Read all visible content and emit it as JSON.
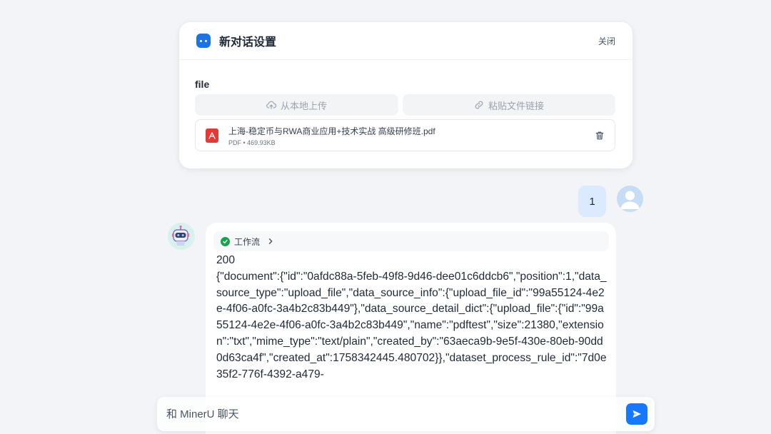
{
  "settings": {
    "title": "新对话设置",
    "close_label": "关闭",
    "field_label": "file",
    "upload_local_label": "从本地上传",
    "paste_link_label": "粘贴文件链接",
    "file": {
      "name": "上海-稳定币与RWA商业应用+技术实战 高级研修班.pdf",
      "info": "PDF • 469.93KB"
    }
  },
  "user_message": {
    "text": "1"
  },
  "bot_message": {
    "workflow_label": "工作流",
    "status_code": "200",
    "body": "{\"document\":{\"id\":\"0afdc88a-5feb-49f8-9d46-dee01c6ddcb6\",\"position\":1,\"data_source_type\":\"upload_file\",\"data_source_info\":{\"upload_file_id\":\"99a55124-4e2e-4f06-a0fc-3a4b2c83b449\"},\"data_source_detail_dict\":{\"upload_file\":{\"id\":\"99a55124-4e2e-4f06-a0fc-3a4b2c83b449\",\"name\":\"pdftest\",\"size\":21380,\"extension\":\"txt\",\"mime_type\":\"text/plain\",\"created_by\":\"63aeca9b-9e5f-430e-80eb-90dd0d63ca4f\",\"created_at\":1758342445.480702}},\"dataset_process_rule_id\":\"7d0e35f2-776f-4392-a479-"
  },
  "input": {
    "placeholder": "和 MinerU 聊天"
  },
  "colors": {
    "accent": "#1677ff",
    "success": "#16a34a",
    "pdf": "#e53935",
    "user_bubble": "#dbeafe"
  }
}
